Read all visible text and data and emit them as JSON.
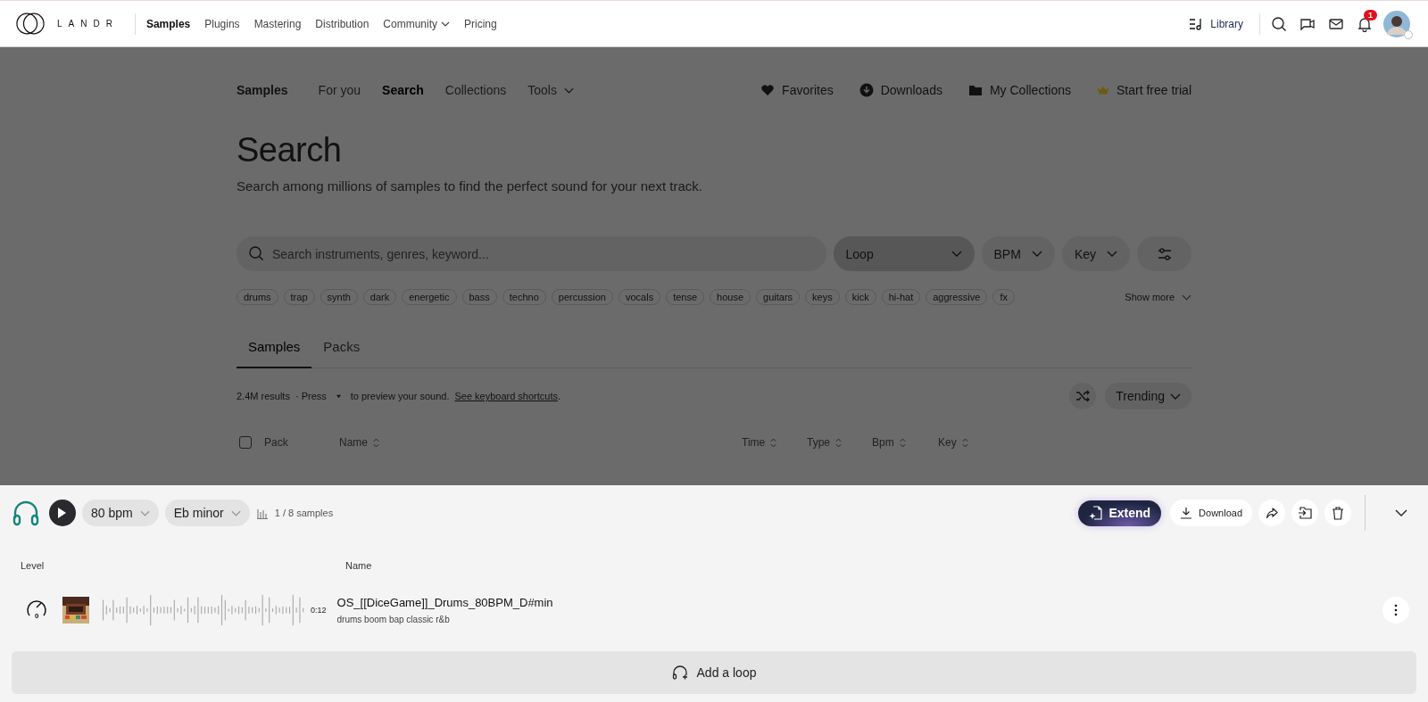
{
  "nav": {
    "logo": "LANDR",
    "items": [
      {
        "label": "Samples",
        "selected": true,
        "dropdown": false
      },
      {
        "label": "Plugins",
        "selected": false,
        "dropdown": false
      },
      {
        "label": "Mastering",
        "selected": false,
        "dropdown": false
      },
      {
        "label": "Distribution",
        "selected": false,
        "dropdown": false
      },
      {
        "label": "Community",
        "selected": false,
        "dropdown": true
      },
      {
        "label": "Pricing",
        "selected": false,
        "dropdown": false
      }
    ],
    "library": "Library",
    "notifications": "1"
  },
  "subnav": {
    "title": "Samples",
    "items": [
      {
        "label": "For you",
        "selected": false,
        "dropdown": false
      },
      {
        "label": "Search",
        "selected": true,
        "dropdown": false
      },
      {
        "label": "Collections",
        "selected": false,
        "dropdown": false
      },
      {
        "label": "Tools",
        "selected": false,
        "dropdown": true
      }
    ],
    "actions": [
      {
        "label": "Favorites",
        "kind": "heart"
      },
      {
        "label": "Downloads",
        "kind": "download"
      },
      {
        "label": "My Collections",
        "kind": "folder"
      },
      {
        "label": "Start free trial",
        "kind": "crown"
      }
    ]
  },
  "heading": "Search",
  "subtitle": "Search among millions of samples to find the perfect sound for your next track.",
  "search": {
    "placeholder": "Search instruments, genres, keyword..."
  },
  "filters": [
    {
      "label": "Loop",
      "selected": true
    },
    {
      "label": "BPM",
      "selected": false
    },
    {
      "label": "Key",
      "selected": false
    }
  ],
  "tags": [
    "drums",
    "trap",
    "synth",
    "dark",
    "energetic",
    "bass",
    "techno",
    "percussion",
    "vocals",
    "tense",
    "house",
    "guitars",
    "keys",
    "kick",
    "hi-hat",
    "aggressive",
    "fx"
  ],
  "show_more": "Show more",
  "result_tabs": [
    {
      "label": "Samples",
      "selected": true
    },
    {
      "label": "Packs",
      "selected": false
    }
  ],
  "results": {
    "count": "2.4M results",
    "hint_before": "· Press",
    "hint_after": "to preview your sound.",
    "link": "See keyboard shortcuts",
    "suffix": "."
  },
  "sort": "Trending",
  "select_all": {
    "checked": false
  },
  "columns": [
    {
      "label": "Pack",
      "sortable": false
    },
    {
      "label": "Name",
      "sortable": true
    },
    {
      "label": "Time",
      "sortable": true
    },
    {
      "label": "Type",
      "sortable": true
    },
    {
      "label": "Bpm",
      "sortable": true
    },
    {
      "label": "Key",
      "sortable": true
    }
  ],
  "player": {
    "bpm": "80 bpm",
    "key": "Eb minor",
    "count": "1 / 8 samples",
    "extend": "Extend",
    "download": "Download",
    "level_header": "Level",
    "name_header": "Name",
    "sample": {
      "level": "0",
      "duration": "0:12",
      "name": "OS_[[DiceGame]]_Drums_80BPM_D#min",
      "tags": "drums boom bap classic r&b"
    },
    "add_loop": "Add a loop"
  }
}
